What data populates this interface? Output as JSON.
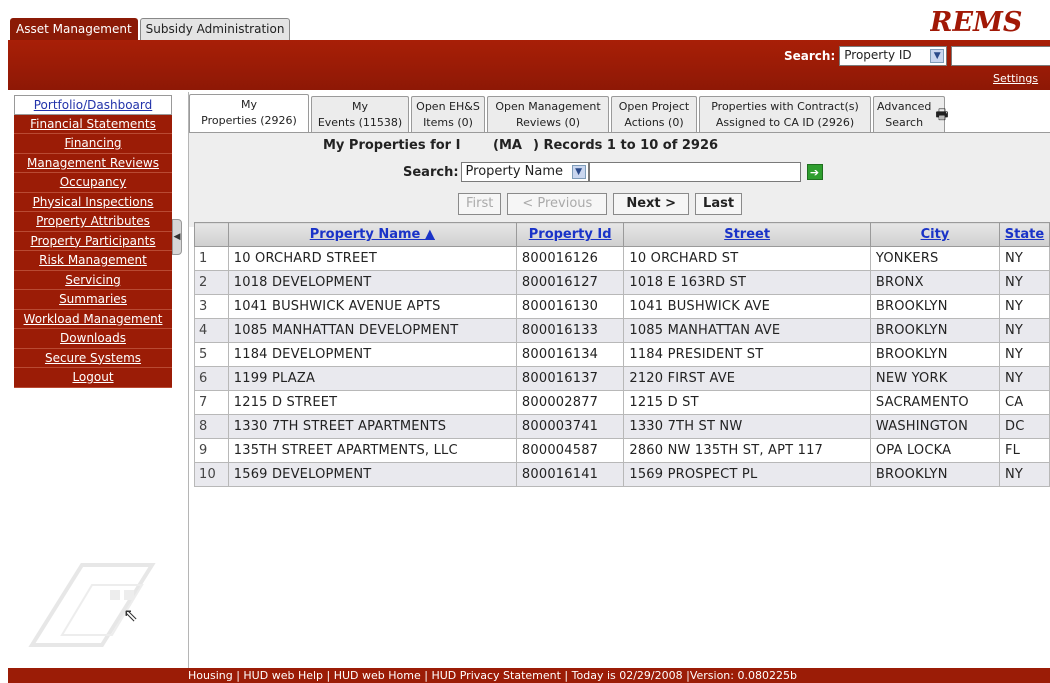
{
  "app_tabs": [
    "Asset Management",
    "Subsidy Administration"
  ],
  "logo": "REMS",
  "header": {
    "search_label": "Search:",
    "search_type": "Property ID",
    "settings": "Settings"
  },
  "nav": [
    "Portfolio/Dashboard",
    "Financial Statements",
    "Financing",
    "Management Reviews",
    "Occupancy",
    "Physical Inspections",
    "Property Attributes",
    "Property Participants",
    "Risk Management",
    "Servicing",
    "Summaries",
    "Workload Management",
    "Downloads",
    "Secure Systems",
    "Logout"
  ],
  "tabs": [
    {
      "l1": "My",
      "l2": "Properties (2926)"
    },
    {
      "l1": "My",
      "l2": "Events (11538)"
    },
    {
      "l1": "Open EH&S",
      "l2": "Items (0)"
    },
    {
      "l1": "Open Management",
      "l2": "Reviews (0)"
    },
    {
      "l1": "Open Project",
      "l2": "Actions (0)"
    },
    {
      "l1": "Properties with Contract(s)",
      "l2": "Assigned to CA ID (2926)"
    },
    {
      "l1": "Advanced",
      "l2": "Search"
    }
  ],
  "records": {
    "prefix": "My Properties for I",
    "middle": "(MA",
    "suffix": ") Records 1 to 10 of 2926"
  },
  "inner_search": {
    "label": "Search:",
    "field": "Property Name"
  },
  "pager": {
    "first": "First",
    "prev": "< Previous",
    "next": "Next >",
    "last": "Last"
  },
  "table": {
    "columns": [
      "",
      "Property Name ▲",
      "Property Id",
      "Street",
      "City",
      "State"
    ],
    "rows": [
      [
        "1",
        "10 ORCHARD STREET",
        "800016126",
        "10 ORCHARD ST",
        "YONKERS",
        "NY"
      ],
      [
        "2",
        "1018 DEVELOPMENT",
        "800016127",
        "1018 E 163RD ST",
        "BRONX",
        "NY"
      ],
      [
        "3",
        "1041 BUSHWICK AVENUE APTS",
        "800016130",
        "1041 BUSHWICK AVE",
        "BROOKLYN",
        "NY"
      ],
      [
        "4",
        "1085 MANHATTAN DEVELOPMENT",
        "800016133",
        "1085 MANHATTAN AVE",
        "BROOKLYN",
        "NY"
      ],
      [
        "5",
        "1184 DEVELOPMENT",
        "800016134",
        "1184 PRESIDENT ST",
        "BROOKLYN",
        "NY"
      ],
      [
        "6",
        "1199 PLAZA",
        "800016137",
        "2120 FIRST AVE",
        "NEW YORK",
        "NY"
      ],
      [
        "7",
        "1215 D STREET",
        "800002877",
        "1215 D ST",
        "SACRAMENTO",
        "CA"
      ],
      [
        "8",
        "1330 7TH STREET APARTMENTS",
        "800003741",
        "1330 7TH ST NW",
        "WASHINGTON",
        "DC"
      ],
      [
        "9",
        "135TH STREET APARTMENTS, LLC",
        "800004587",
        "2860 NW 135TH ST, APT 117",
        "OPA LOCKA",
        "FL"
      ],
      [
        "10",
        "1569 DEVELOPMENT",
        "800016141",
        "1569 PROSPECT PL",
        "BROOKLYN",
        "NY"
      ]
    ]
  },
  "footer": "Housing | HUD web Help | HUD web Home | HUD Privacy Statement | Today is 02/29/2008 |Version: 0.080225b"
}
